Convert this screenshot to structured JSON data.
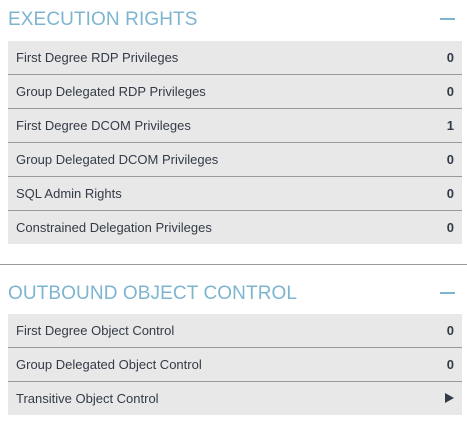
{
  "execution_rights": {
    "title": "EXECUTION RIGHTS",
    "items": [
      {
        "label": "First Degree RDP Privileges",
        "value": "0"
      },
      {
        "label": "Group Delegated RDP Privileges",
        "value": "0"
      },
      {
        "label": "First Degree DCOM Privileges",
        "value": "1"
      },
      {
        "label": "Group Delegated DCOM Privileges",
        "value": "0"
      },
      {
        "label": "SQL Admin Rights",
        "value": "0"
      },
      {
        "label": "Constrained Delegation Privileges",
        "value": "0"
      }
    ]
  },
  "outbound_object_control": {
    "title": "OUTBOUND OBJECT CONTROL",
    "items": [
      {
        "label": "First Degree Object Control",
        "value": "0"
      },
      {
        "label": "Group Delegated Object Control",
        "value": "0"
      },
      {
        "label": "Transitive Object Control",
        "icon": "play-arrow-icon"
      }
    ]
  },
  "colors": {
    "accent": "#7db5d1",
    "row_bg": "#e8e8e8",
    "text": "#333b47"
  }
}
